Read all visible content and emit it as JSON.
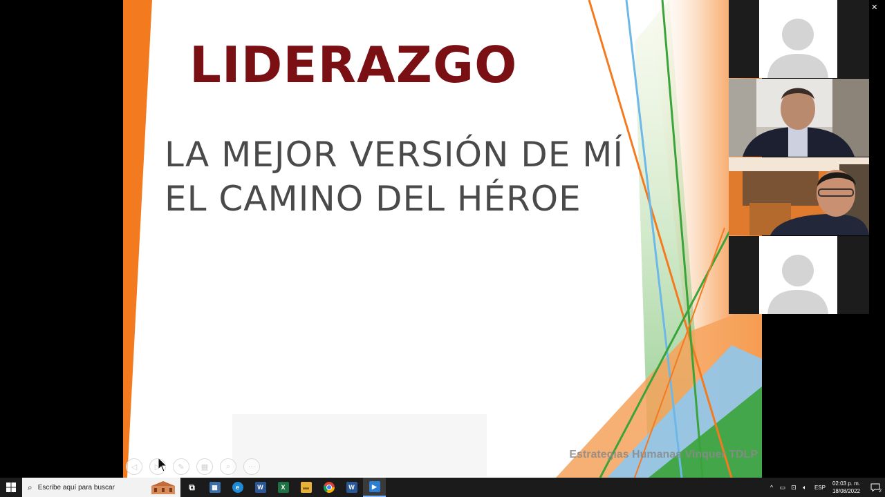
{
  "window": {
    "minimize": "—",
    "restore": "❐",
    "close": "✕"
  },
  "slide": {
    "title": "LIDERAZGO",
    "subtitle_line1": "LA MEJOR VERSIÓN DE MÍ",
    "subtitle_line2": "EL CAMINO DEL HÉROE",
    "footer": "Estrategias Humanas Vinquer TDLP",
    "toolbar": {
      "prev": "◁",
      "next": "▷",
      "pen": "✎",
      "slides": "▦",
      "zoom": "⌕",
      "more": "···"
    },
    "colors": {
      "title": "#7a1014",
      "subtitle": "#4a4a4a",
      "orange": "#f47a20",
      "green": "#3aa33a",
      "blue": "#6cb8e8"
    }
  },
  "participants": [
    {
      "type": "avatar",
      "icon": "person-silhouette-icon"
    },
    {
      "type": "video",
      "icon": "participant-video"
    },
    {
      "type": "video",
      "icon": "participant-video"
    },
    {
      "type": "avatar",
      "icon": "person-silhouette-icon"
    }
  ],
  "taskbar": {
    "search_placeholder": "Escribe aquí para buscar",
    "apps": [
      {
        "name": "task-view",
        "glyph": "⧉",
        "color": "#1b1b1b"
      },
      {
        "name": "calculator",
        "glyph": "▦",
        "color": "#3c6ea8"
      },
      {
        "name": "edge",
        "glyph": "e",
        "color": "#1f8ad6"
      },
      {
        "name": "word",
        "glyph": "W",
        "color": "#2b5797"
      },
      {
        "name": "excel",
        "glyph": "X",
        "color": "#1e7145"
      },
      {
        "name": "file-explorer",
        "glyph": "▬",
        "color": "#e8b23a"
      },
      {
        "name": "chrome",
        "glyph": "●",
        "color": "#db4437"
      },
      {
        "name": "word-2",
        "glyph": "W",
        "color": "#2b5797"
      },
      {
        "name": "presenter",
        "glyph": "▶",
        "color": "#2d7dd2"
      }
    ],
    "tray": {
      "language": "ESP",
      "time": "02:03 p. m.",
      "date": "18/08/2022",
      "notifications": "2"
    }
  }
}
